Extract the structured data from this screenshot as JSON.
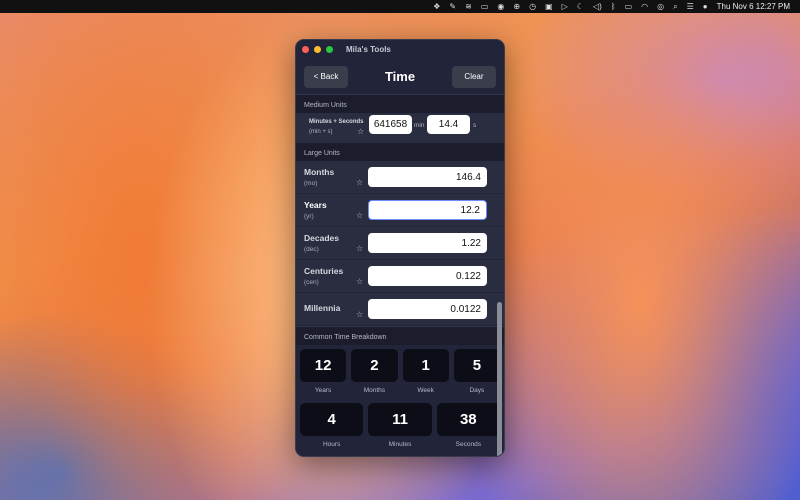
{
  "menubar": {
    "icons": [
      "dropbox-icon",
      "script-icon",
      "swirl-icon",
      "screen-icon",
      "chrome-icon",
      "globe-icon",
      "timer-icon",
      "b-icon",
      "play-icon",
      "moon-icon",
      "volume-icon",
      "bluetooth-icon",
      "battery-icon",
      "wifi-icon",
      "user-icon",
      "search-icon",
      "control-center-icon",
      "siri-icon"
    ],
    "clock": "Thu Nov 6  12:27 PM"
  },
  "window": {
    "title": "Mila's Tools",
    "back_label": "< Back",
    "page_title": "Time",
    "clear_label": "Clear"
  },
  "medium_units": {
    "section_title": "Medium Units",
    "row": {
      "label": "Minutes + Seconds",
      "sub": "(min + s)",
      "minutes_value": "641658",
      "minutes_unit": "min",
      "seconds_value": "14.4",
      "seconds_unit": "s"
    }
  },
  "large_units": {
    "section_title": "Large Units",
    "rows": [
      {
        "label": "Months",
        "sub": "(mo)",
        "value": "146.4"
      },
      {
        "label": "Years",
        "sub": "(yr)",
        "value": "12.2"
      },
      {
        "label": "Decades",
        "sub": "(dec)",
        "value": "1.22"
      },
      {
        "label": "Centuries",
        "sub": "(cen)",
        "value": "0.122"
      },
      {
        "label": "Millennia",
        "sub": "",
        "value": "0.0122"
      }
    ]
  },
  "breakdown": {
    "section_title": "Common Time Breakdown",
    "row1": [
      {
        "value": "12",
        "label": "Years"
      },
      {
        "value": "2",
        "label": "Months"
      },
      {
        "value": "1",
        "label": "Week"
      },
      {
        "value": "5",
        "label": "Days"
      }
    ],
    "row2": [
      {
        "value": "4",
        "label": "Hours"
      },
      {
        "value": "11",
        "label": "Minutes"
      },
      {
        "value": "38",
        "label": "Seconds"
      }
    ]
  },
  "star_glyph": "☆"
}
